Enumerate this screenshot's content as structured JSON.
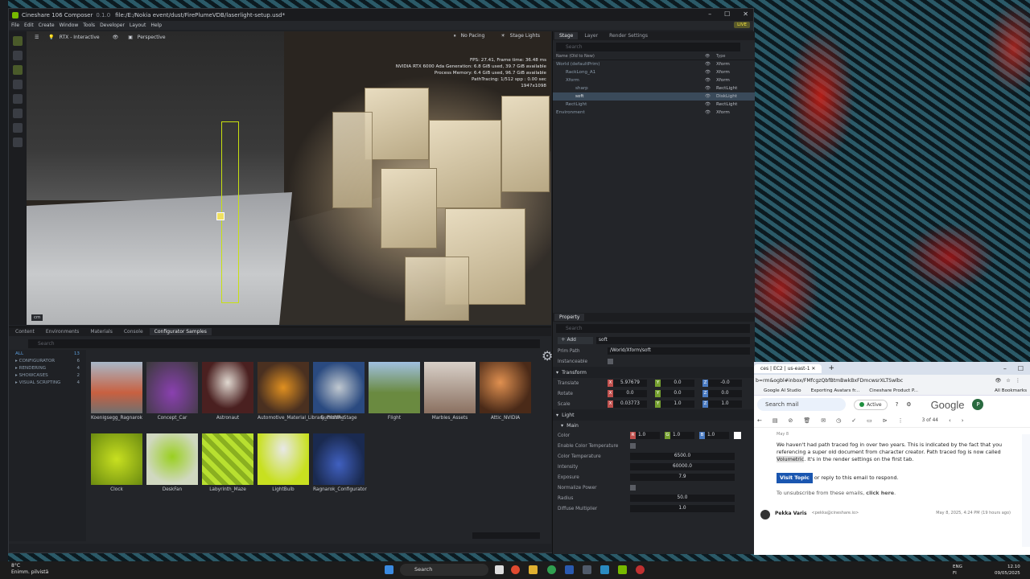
{
  "window": {
    "app_name": "Cineshare 106 Composer",
    "version": "0.1.0",
    "file_path": "file:/E:/Nokia event/dust/FirePlumeVDB/laserlight-setup.usd*",
    "menu": [
      "File",
      "Edit",
      "Create",
      "Window",
      "Tools",
      "Developer",
      "Layout",
      "Help"
    ],
    "live_badge": "LIVE"
  },
  "viewport": {
    "renderer": "RTX - Interactive",
    "camera": "Perspective",
    "pacing": "No Pacing",
    "lights": "Stage Lights",
    "hud": [
      "FPS: 27.41, Frame time: 36.48 ms",
      "NVIDIA RTX 6000 Ada Generation: 6.8 GiB used, 39.7 GiB available",
      "Process Memory: 6.4 GiB used, 96.7 GiB available",
      "PathTracing: 1/512 spp : 0.00 sec",
      "1947x1098"
    ],
    "unit": "cm"
  },
  "stage": {
    "tabs": [
      "Stage",
      "Layer",
      "Render Settings"
    ],
    "search_placeholder": "Search",
    "col_name": "Name (Old to New)",
    "col_type": "Type",
    "rows": [
      {
        "name": "World (defaultPrim)",
        "type": "Xform"
      },
      {
        "name": "RackLong_A1",
        "type": "Xform"
      },
      {
        "name": "Xform",
        "type": "Xform"
      },
      {
        "name": "sharp",
        "type": "RectLight"
      },
      {
        "name": "soft",
        "type": "DiskLight"
      },
      {
        "name": "RectLight",
        "type": "RectLight"
      },
      {
        "name": "Environment",
        "type": "Xform"
      }
    ]
  },
  "property": {
    "tab": "Property",
    "search_placeholder": "Search",
    "add_label": "Add",
    "name_value": "soft",
    "prim_path_label": "Prim Path",
    "prim_path": "/World/Xform/soft",
    "instanceable_label": "Instanceable",
    "transform_label": "Transform",
    "translate_label": "Translate",
    "translate": [
      "5.97679",
      "0.0",
      "-0.0"
    ],
    "rotate_label": "Rotate",
    "rotate": [
      "0.0",
      "0.0",
      "0.0"
    ],
    "scale_label": "Scale",
    "scale": [
      "0.03773",
      "1.0",
      "1.0"
    ],
    "light_label": "Light",
    "main_label": "Main",
    "color_label": "Color",
    "color": [
      "1.0",
      "1.0",
      "1.0"
    ],
    "enable_ct_label": "Enable Color Temperature",
    "ct_label": "Color Temperature",
    "ct_value": "6500.0",
    "intensity_label": "Intensity",
    "intensity_value": "60000.0",
    "exposure_label": "Exposure",
    "exposure_value": "7.9",
    "normalize_label": "Normalize Power",
    "radius_label": "Radius",
    "radius_value": "50.0",
    "diffuse_label": "Diffuse Multiplier",
    "diffuse_value": "1.0"
  },
  "content": {
    "tabs": [
      "Content",
      "Environments",
      "Materials",
      "Console",
      "Configurator Samples"
    ],
    "search_placeholder": "Search",
    "categories": [
      {
        "name": "ALL",
        "count": "13"
      },
      {
        "name": "CONFIGURATOR",
        "count": "6"
      },
      {
        "name": "RENDERING",
        "count": "4"
      },
      {
        "name": "SHOWCASES",
        "count": "2"
      },
      {
        "name": "VISUAL SCRIPTING",
        "count": "4"
      }
    ],
    "items": [
      "Koenigsegg_Ragnarok",
      "Concept_Car",
      "Astronaut",
      "Automotive_Material_Library_Pristine",
      "EuclidVR_Stage",
      "Flight",
      "Marbles_Assets",
      "Attic_NVIDIA",
      "Clock",
      "DeskFan",
      "Labyrinth_Maze",
      "LightBulb",
      "Ragnarok_Configurator"
    ]
  },
  "browser": {
    "tab_title": "ces | EC2 | us-east-1",
    "url": "b=rm&ogbl#inbox/FMfcgzQbfBtmBwkBxFDmcwsrXLTSwlbc",
    "bookmarks": [
      "Google AI Studio",
      "Exporting Avatars fr...",
      "Cineshare Product P...",
      "All Bookmarks"
    ],
    "search_mail": "Search mail",
    "active": "Active",
    "google": "Google",
    "avatar_letter": "P",
    "pagination": "3 of 44",
    "email_date_small": "May 8",
    "email_body": "We haven't had path traced fog in over two years. This is indicated by the fact that you referencing a super old document from character creator. Path traced fog is now called",
    "email_highlight": "Volumetric",
    "email_body2": ". It's in the render settings on the first tab.",
    "visit_topic": "Visit Topic",
    "reply_text": "or reply to this email to respond.",
    "unsubscribe_text": "To unsubscribe from these emails,",
    "click_here": "click here",
    "sender_name": "Pekka Varis",
    "sender_email": "<pekka@cineshare.io>",
    "sender_date": "May 8, 2025, 4:24 PM (19 hours ago)"
  },
  "taskbar": {
    "weather_temp": "8°C",
    "weather_desc": "Enimm. pilvistä",
    "search": "Search",
    "lang": "ENG",
    "lang2": "FI",
    "time": "12.10",
    "date": "09/05/2025"
  }
}
